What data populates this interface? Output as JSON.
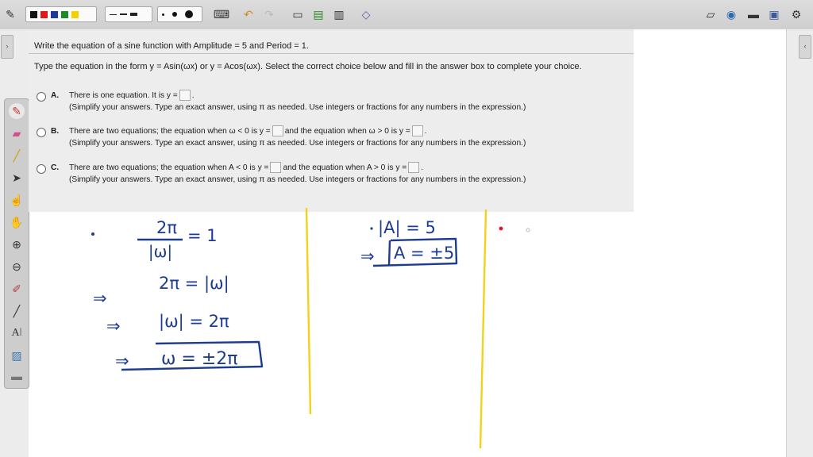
{
  "question": {
    "title": "Write the equation of a sine function with Amplitude = 5 and Period = 1.",
    "instruction": "Type the equation in the form y = Asin(ωx) or y = Acos(ωx). Select the correct choice below and fill in the answer box to complete your choice.",
    "choices": [
      {
        "letter": "A.",
        "line1": "There is one equation. It is y =",
        "line1_end": ".",
        "line2": "(Simplify your answers. Type an exact answer, using π as needed. Use integers or fractions for any numbers in the expression.)"
      },
      {
        "letter": "B.",
        "line1a": "There are two equations; the equation when ω < 0 is y =",
        "line1b": "and the equation when ω > 0 is y =",
        "line1_end": ".",
        "line2": "(Simplify your answers. Type an exact answer, using π as needed. Use integers or fractions for any numbers in the expression.)"
      },
      {
        "letter": "C.",
        "line1a": "There are two equations; the equation when A < 0 is y =",
        "line1b": "and the equation when A > 0 is y =",
        "line1_end": ".",
        "line2": "(Simplify your answers. Type an exact answer, using π as needed. Use integers or fractions for any numbers in the expression.)"
      }
    ]
  },
  "colors": {
    "ink_blue": "#1d3c8f",
    "divider_yellow": "#f2d21b",
    "red_dot": "#e0141e"
  },
  "toolbar_icons": [
    "pen-settings-icon",
    "color-palette",
    "line-width-palette",
    "dot-size-palette",
    "keyboard-icon",
    "undo-icon",
    "redo-icon",
    "new-page-icon",
    "insert-page-icon",
    "document-icon",
    "shapes-icon"
  ],
  "toolbar_right_icons": [
    "edit-icon",
    "globe-icon",
    "folder-icon",
    "display-icon",
    "settings-icon"
  ],
  "side_tools": [
    "pen-tool-icon",
    "eraser-icon",
    "highlighter-icon",
    "pointer-icon",
    "hand-pointer-icon",
    "pan-hand-icon",
    "zoom-in-icon",
    "zoom-out-icon",
    "eyedropper-icon",
    "line-tool-icon",
    "text-tool-icon",
    "image-tool-icon",
    "ruler-icon"
  ],
  "handwriting": {
    "left_eq1_num": "2π",
    "left_eq1_den": "|ω|",
    "left_eq1_rhs": "= 1",
    "left_eq2": "2π = |ω|",
    "left_eq3": "|ω| = 2π",
    "left_eq4": "ω = ±2π",
    "mid_eq1": "|A| = 5",
    "mid_eq2": "A = ±5"
  }
}
